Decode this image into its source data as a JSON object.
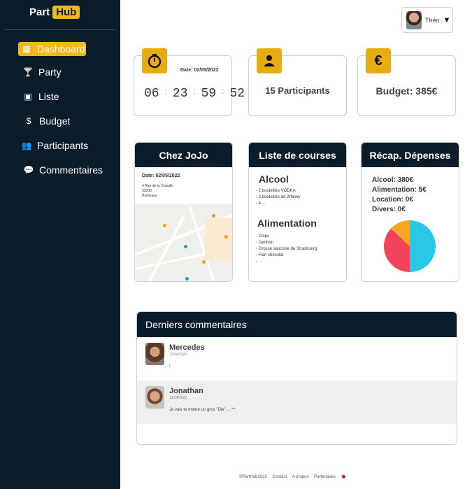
{
  "app": {
    "logo_left": "Part",
    "logo_right": "Hub"
  },
  "sidebar": {
    "items": [
      {
        "label": "Dashboard",
        "icon": "dashboard-icon"
      },
      {
        "label": "Party",
        "icon": "cocktail-icon"
      },
      {
        "label": "Liste",
        "icon": "couch-icon"
      },
      {
        "label": "Budget",
        "icon": "dollar-icon"
      },
      {
        "label": "Participants",
        "icon": "users-icon"
      },
      {
        "label": "Commentaires",
        "icon": "comment-icon"
      }
    ]
  },
  "user": {
    "name": "Théo",
    "caret": "▼"
  },
  "cards": {
    "countdown": {
      "date": "Date: 02/05/2022",
      "values": [
        "06",
        "23",
        "59",
        "52"
      ],
      "separator": ":"
    },
    "participants": {
      "text": "15 Participants"
    },
    "budget": {
      "symbol": "€",
      "text": "Budget: 385€"
    }
  },
  "venue": {
    "title": "Chez JoJo",
    "date": "Date: 02/05/2022",
    "address_1": "4 Rue de la Coquille",
    "address_2": "33000",
    "address_3": "Bordeaux"
  },
  "shopping": {
    "title": "Liste de courses",
    "sections": [
      {
        "name": "Alcool",
        "items": [
          "- 2 bouteilles VODKA",
          "- 2 bouteilles de Whisky",
          "- 4 ..."
        ]
      },
      {
        "name": "Alimentation",
        "items": [
          "- Chips",
          "- Jambon",
          "- Grosse saucisse de Strasbourg",
          "- Flan chocolat",
          "- ..."
        ]
      }
    ]
  },
  "expenses": {
    "title": "Récap. Dépenses",
    "lines": [
      "Alcool: 380€",
      "Alimentation: 5€",
      "Location: 0€",
      "Divers: 0€"
    ]
  },
  "chart_data": {
    "type": "pie",
    "series": [
      {
        "name": "",
        "values": [
          50,
          37,
          13
        ],
        "colors": [
          "#2ac8e8",
          "#f2435a",
          "#f5a623"
        ]
      }
    ]
  },
  "comments": {
    "title": "Derniers commentaires",
    "items": [
      {
        "author": "Mercedes",
        "date": "13/04/2022",
        "text": "!"
      },
      {
        "author": "Jonathan",
        "date": "13/04/2022",
        "text": "Je vais te mettre un gros \"Die\" ... ^^"
      }
    ]
  },
  "footer": {
    "copyright": "©PartHub2022",
    "contact": "Contact",
    "about": "A propos",
    "partners": "Partenaires"
  }
}
